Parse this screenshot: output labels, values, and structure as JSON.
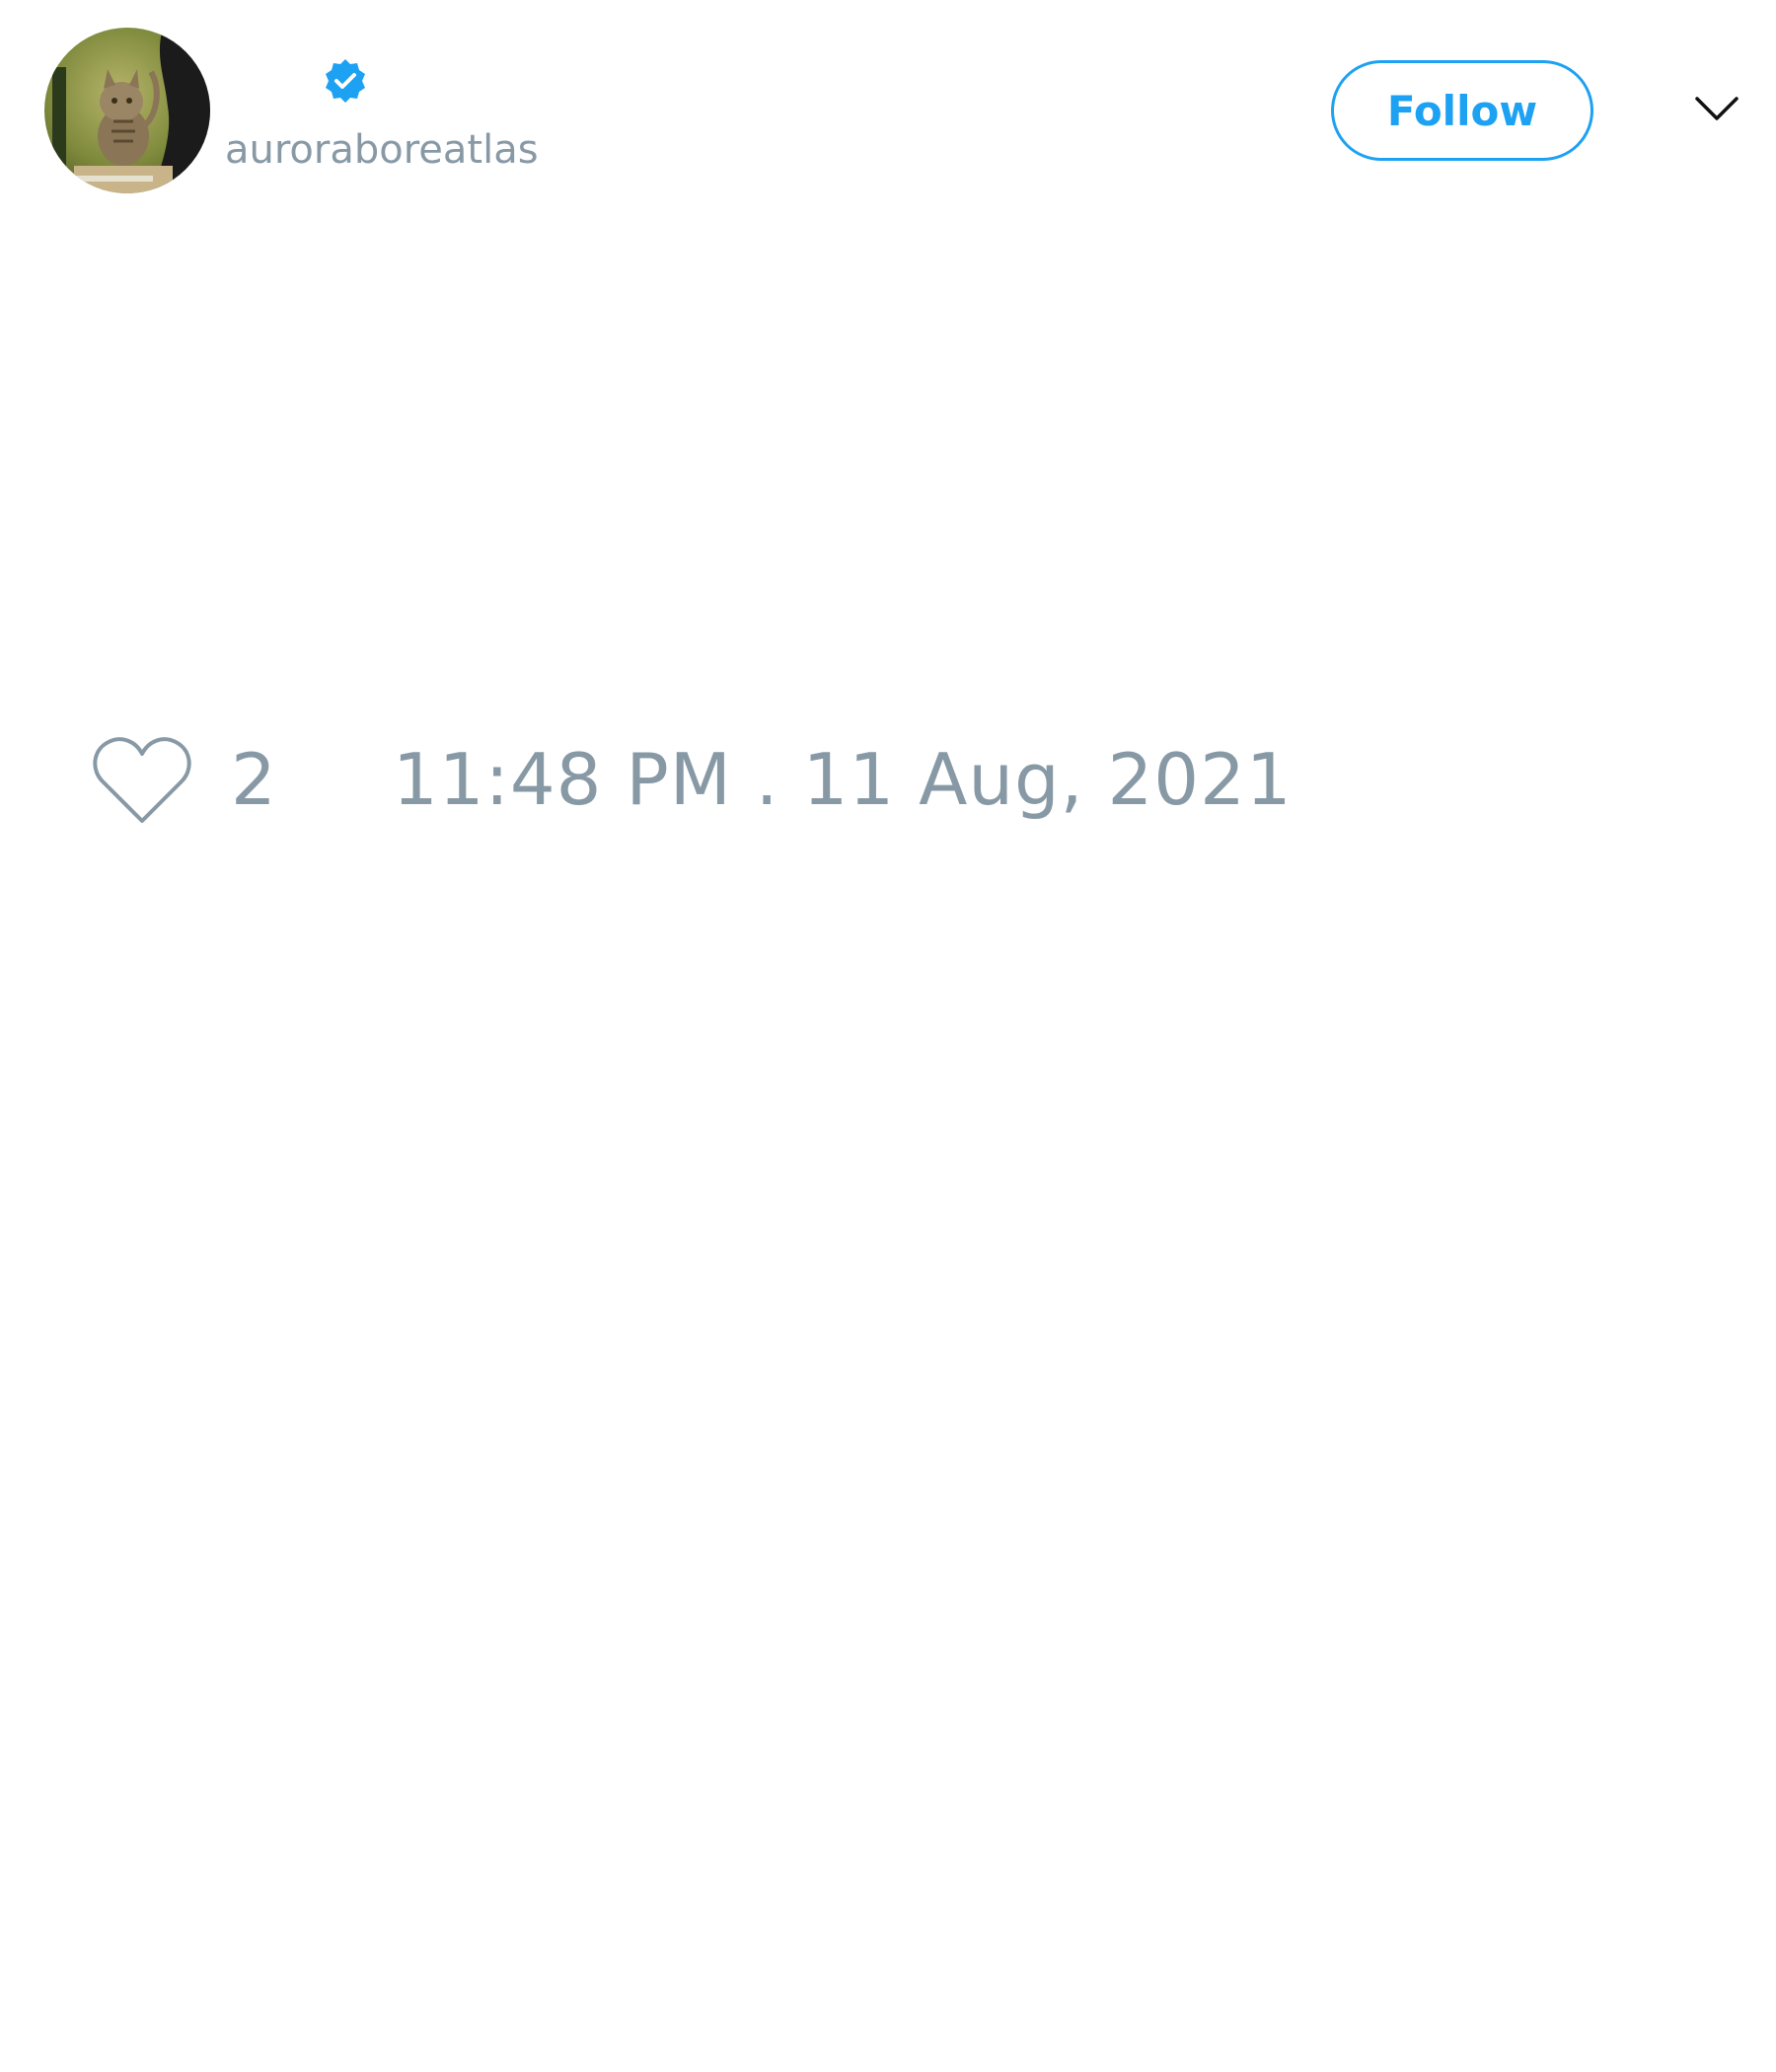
{
  "tweet": {
    "author": {
      "display_name": "",
      "handle": "auroraboreatlas",
      "verified": true,
      "avatar_description": "tabby-kitten-avatar"
    },
    "follow_label": "Follow",
    "menu_icon": "chevron-down-icon",
    "like_icon": "heart-outline-icon",
    "like_count": "2",
    "timestamp": "11:48 PM . 11 Aug, 2021"
  },
  "colors": {
    "accent": "#1da1f2",
    "muted_text": "#8899a6",
    "background": "#ffffff"
  }
}
